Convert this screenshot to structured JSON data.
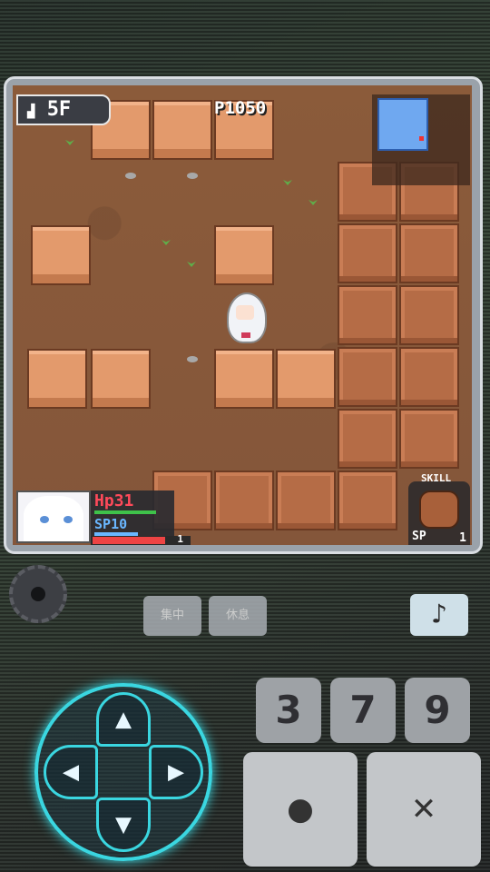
{
  "hud": {
    "floor": "5F",
    "points": "P1050",
    "hp_label": "Hp",
    "hp_value": "31",
    "sp_label": "SP",
    "sp_value": "10",
    "hp_fraction": 0.85,
    "sp_fraction": 0.6,
    "level": "1",
    "skill_label": "SKILL",
    "skill_sp": "SP",
    "skill_count": "1"
  },
  "controls": {
    "btn_left": "集中",
    "btn_right": "休息",
    "music_icon": "♪",
    "key_3": "3",
    "key_7": "7",
    "key_9": "9",
    "confirm_glyph": "●",
    "cancel_glyph": "✕",
    "dpad_up": "▲",
    "dpad_down": "▼",
    "dpad_left": "◀",
    "dpad_right": "▶"
  },
  "colors": {
    "dpad_accent": "#3ad6e0",
    "hp": "#ff4a5a",
    "sp": "#6ab7ff"
  }
}
